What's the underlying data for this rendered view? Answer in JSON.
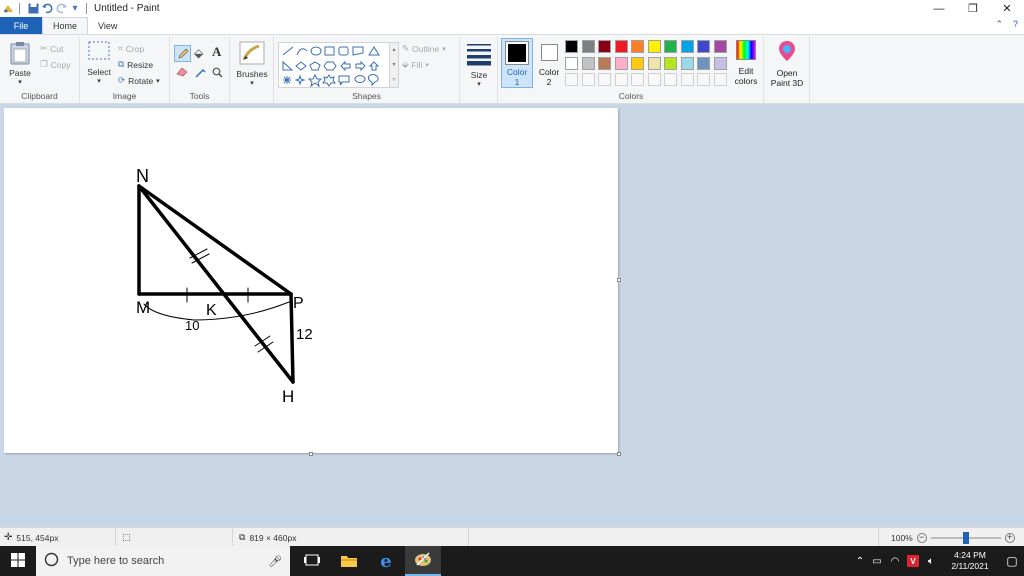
{
  "titlebar": {
    "title": "Untitled - Paint"
  },
  "tabs": [
    {
      "label": "File"
    },
    {
      "label": "Home"
    },
    {
      "label": "View"
    }
  ],
  "ribbon": {
    "clipboard": {
      "paste": "Paste",
      "cut": "Cut",
      "copy": "Copy",
      "label": "Clipboard"
    },
    "image": {
      "select": "Select",
      "crop": "Crop",
      "resize": "Resize",
      "rotate": "Rotate",
      "label": "Image"
    },
    "tools": {
      "label": "Tools"
    },
    "brushes": {
      "label": "Brushes"
    },
    "shapes": {
      "outline": "Outline",
      "fill": "Fill",
      "label": "Shapes"
    },
    "size": {
      "label": "Size"
    },
    "color1": {
      "line1": "Color",
      "line2": "1"
    },
    "color2": {
      "line1": "Color",
      "line2": "2"
    },
    "edit_colors": {
      "line1": "Edit",
      "line2": "colors"
    },
    "paint3d": {
      "line1": "Open",
      "line2": "Paint 3D"
    },
    "colors": {
      "label": "Colors"
    },
    "palette_row1": [
      "#000000",
      "#7f7f7f",
      "#880015",
      "#ed1c24",
      "#ff7f27",
      "#fff200",
      "#22b14c",
      "#00a2e8",
      "#3f48cc",
      "#a349a4"
    ],
    "palette_row2": [
      "#ffffff",
      "#c3c3c3",
      "#b97a57",
      "#ffaec9",
      "#ffc90e",
      "#efe4b0",
      "#b5e61d",
      "#99d9ea",
      "#7092be",
      "#c8bfe7"
    ]
  },
  "drawing": {
    "labels": {
      "n": "N",
      "m": "M",
      "k": "K",
      "p": "P",
      "h": "H",
      "ten": "10",
      "twelve": "12"
    }
  },
  "statusbar": {
    "cursor": "515, 454px",
    "size": "819 × 460px",
    "zoom": "100%",
    "zoom_level": 0.5
  },
  "taskbar": {
    "search_placeholder": "Type here to search",
    "time": "4:24 PM",
    "date": "2/11/2021"
  }
}
